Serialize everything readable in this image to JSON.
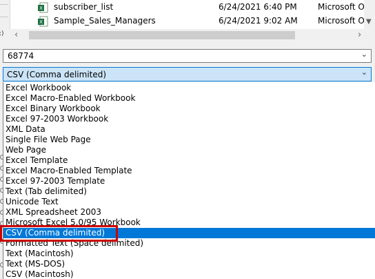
{
  "files": [
    {
      "name": "subscriber_list",
      "date": "6/24/2021 6:40 PM",
      "type": "Microsoft Of"
    },
    {
      "name": "Sample_Sales_Managers",
      "date": "6/24/2021 9:02 AM",
      "type": "Microsoft Of"
    }
  ],
  "sidebar_label": ":)",
  "file_name": {
    "value": "68774"
  },
  "save_as_type": {
    "value": "CSV (Comma delimited)"
  },
  "type_options": [
    "Excel Workbook",
    "Excel Macro-Enabled Workbook",
    "Excel Binary Workbook",
    "Excel 97-2003 Workbook",
    "XML Data",
    "Single File Web Page",
    "Web Page",
    "Excel Template",
    "Excel Macro-Enabled Template",
    "Excel 97-2003 Template",
    "Text (Tab delimited)",
    "Unicode Text",
    "XML Spreadsheet 2003",
    "Microsoft Excel 5.0/95 Workbook",
    "CSV (Comma delimited)",
    "Formatted Text (Space delimited)",
    "Text (Macintosh)",
    "Text (MS-DOS)",
    "CSV (Macintosh)"
  ],
  "selected_option_index": 14,
  "colors": {
    "selection": "#0078d7",
    "highlight_border": "#cc0000",
    "combo_focus": "#cce4f7"
  },
  "icons": {
    "file": "excel-file-icon",
    "dropdown": "chevron-down-icon"
  }
}
